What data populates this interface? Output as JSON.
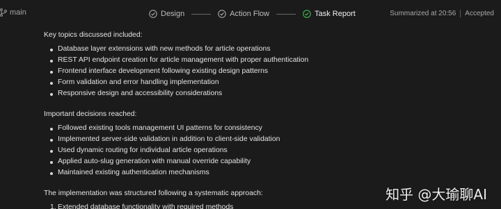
{
  "header": {
    "branch_label": "main",
    "steps": [
      {
        "label": "Design",
        "state": "done"
      },
      {
        "label": "Action Flow",
        "state": "done"
      },
      {
        "label": "Task Report",
        "state": "active"
      }
    ],
    "summarized": "Summarized at 20:56",
    "accepted": "Accepted"
  },
  "report": {
    "topics_heading": "Key topics discussed included:",
    "topics": [
      "Database layer extensions with new methods for article operations",
      "REST API endpoint creation for article management with proper authentication",
      "Frontend interface development following existing design patterns",
      "Form validation and error handling implementation",
      "Responsive design and accessibility considerations"
    ],
    "decisions_heading": "Important decisions reached:",
    "decisions": [
      "Followed existing tools management UI patterns for consistency",
      "Implemented server-side validation in addition to client-side validation",
      "Used dynamic routing for individual article operations",
      "Applied auto-slug generation with manual override capability",
      "Maintained existing authentication mechanisms"
    ],
    "impl_heading": "The implementation was structured following a systematic approach:",
    "impl_steps": [
      {
        "num": "1.",
        "text": "Extended database functionality with required methods"
      }
    ]
  },
  "watermark": "知乎 @大瑜聊AI",
  "colors": {
    "background": "#1b1b1b",
    "text": "#e4e4e4",
    "muted": "#a8a8a8",
    "step_done": "#bdbdbd",
    "step_active": "#3fb950"
  },
  "icons": {
    "branch": "git-branch-icon",
    "step_done": "check-circle-icon",
    "step_active": "check-circle-green-icon"
  }
}
